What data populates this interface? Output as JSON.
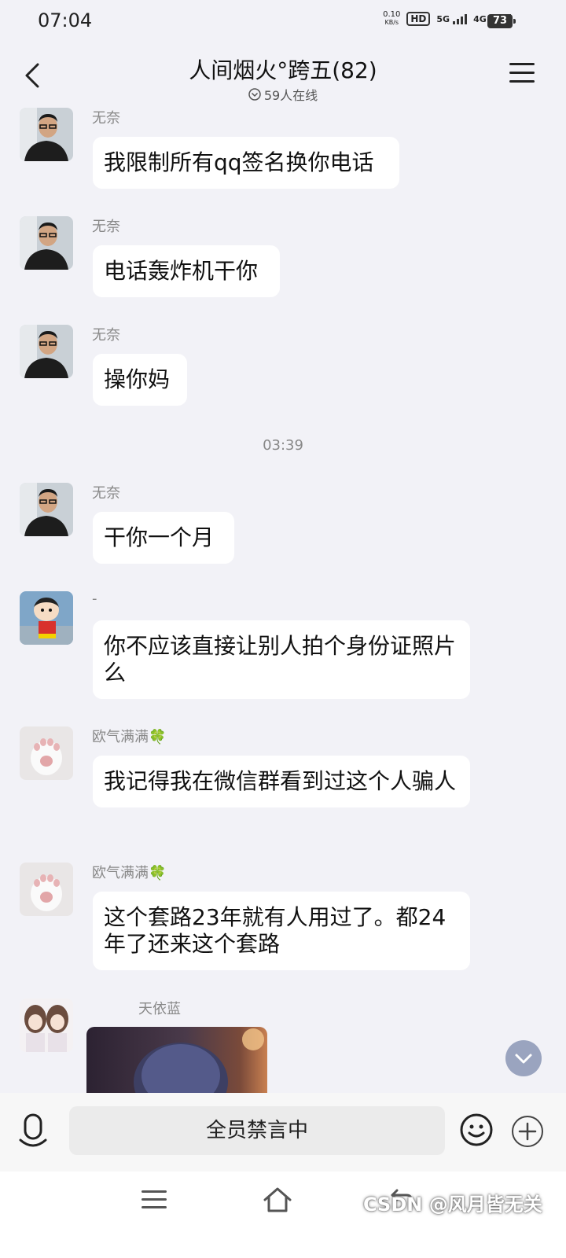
{
  "status_bar": {
    "time": "07:04",
    "net_speed_value": "0.10",
    "net_speed_unit": "KB/s",
    "hd": "HD",
    "sim1": "5G",
    "sim2": "4G+",
    "battery": "73"
  },
  "header": {
    "title": "人间烟火°跨五(82)",
    "online": "59人在线"
  },
  "time_separator": "03:39",
  "messages": [
    {
      "sender": "无奈",
      "text": "我限制所有qq签名换你电话"
    },
    {
      "sender": "无奈",
      "text": "电话轰炸机干你"
    },
    {
      "sender": "无奈",
      "text": "操你妈"
    },
    {
      "sender": "无奈",
      "text": "干你一个月"
    },
    {
      "sender": "-",
      "text": "你不应该直接让别人拍个身份证照片么"
    },
    {
      "sender": "欧气满满🍀",
      "text": "我记得我在微信群看到过这个人骗人"
    },
    {
      "sender": "欧气满满🍀",
      "text": "这个套路23年就有人用过了。都24年了还来这个套路"
    },
    {
      "sender": "天依蓝",
      "text": ""
    }
  ],
  "input": {
    "placeholder": "全员禁言中"
  },
  "watermark": "CSDN @风月皆无关",
  "icons": [
    "back-arrow-icon",
    "menu-icon",
    "online-chevron-icon",
    "voice-icon",
    "emoji-icon",
    "plus-icon",
    "scroll-down-icon",
    "nav-menu-icon",
    "nav-home-icon",
    "nav-back-icon"
  ]
}
